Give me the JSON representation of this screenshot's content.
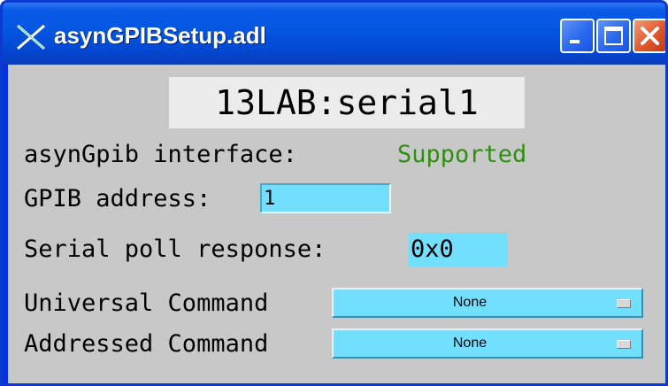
{
  "window": {
    "title": "asynGPIBSetup.adl",
    "icons": {
      "app": "x-logo-icon",
      "minimize": "minimize-icon",
      "maximize": "maximize-icon",
      "close": "close-icon"
    }
  },
  "pv_name": "13LAB:serial1",
  "interface": {
    "label": "asynGpib interface:",
    "status": "Supported",
    "status_color": "#2f8f10"
  },
  "gpib_address": {
    "label": "GPIB address:",
    "value": "1"
  },
  "serial_poll": {
    "label": "Serial poll response:",
    "value": "0x0"
  },
  "universal_command": {
    "label": "Universal Command",
    "selected": "None"
  },
  "addressed_command": {
    "label": "Addressed Command",
    "selected": "None"
  },
  "colors": {
    "panel_bg": "#c8c8c8",
    "control_bg": "#73dfff",
    "title_bg": "#ececec"
  }
}
